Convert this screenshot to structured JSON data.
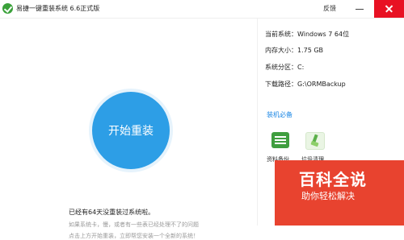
{
  "titlebar": {
    "title": "易捷一键重装系统 6.6正式版",
    "feedback_label": "反馈"
  },
  "main": {
    "install_button_label": "开始重装",
    "days_message": "已经有64天没重装过系统啦。",
    "hint_line_1": "如果系统卡，慢，或者有一些表已经处理不了的问题",
    "hint_line_2": "点击上方开始重装，立即帮您安装一个全新的系统！"
  },
  "system_info": {
    "current_system": "当前系统：Windows 7 64位",
    "memory": "内存大小：1.75 GB",
    "partition": "系统分区：C:",
    "download_path": "下载路径：G:\\ORMBackup"
  },
  "tools": {
    "title": "装机必备",
    "items": [
      {
        "label": "资料备份",
        "icon": "backup-icon"
      },
      {
        "label": "垃圾清理",
        "icon": "broom-icon"
      }
    ]
  },
  "watermark": {
    "main": "百科全说",
    "sub": "助你轻松解决"
  },
  "colors": {
    "accent": "#2d9ee6",
    "close_red": "#e81123",
    "watermark_red": "#e8432f",
    "link_blue": "#1e88e5"
  }
}
